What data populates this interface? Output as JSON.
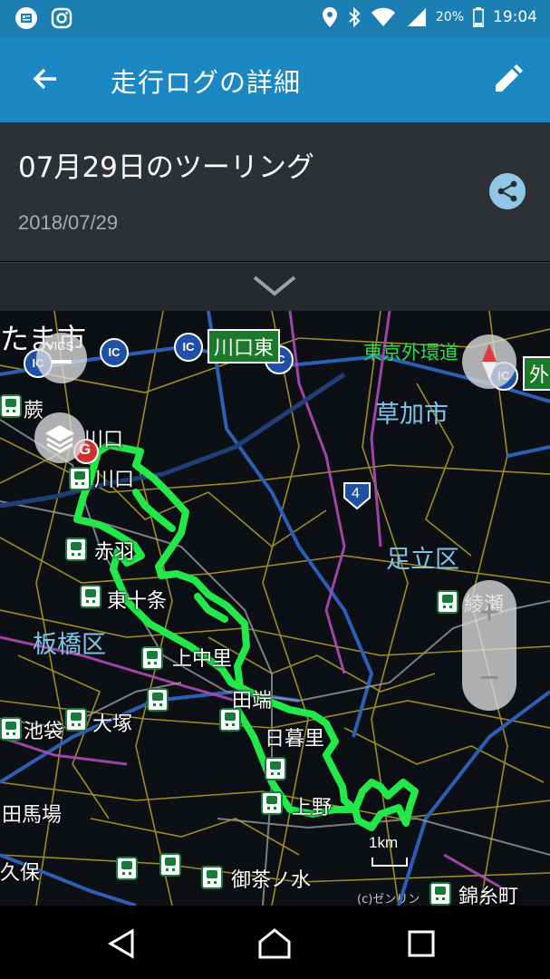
{
  "status_bar": {
    "left_icons": [
      "news-icon",
      "instagram-icon"
    ],
    "right_icons": [
      "location-icon",
      "bluetooth-icon",
      "wifi-icon",
      "signal-icon"
    ],
    "battery": "20%",
    "time": "19:04"
  },
  "app_bar": {
    "title": "走行ログの詳細",
    "back_icon": "arrow-back-icon",
    "edit_icon": "pencil-icon"
  },
  "trip": {
    "title": "07月29日のツーリング",
    "date": "2018/07/29",
    "share_icon": "share-icon"
  },
  "expander": {
    "icon": "chevron-down-icon"
  },
  "map": {
    "vics_label": "VICS",
    "ic_label": "IC",
    "goal_marker": "G",
    "route_number": "4",
    "signs": [
      "川口東",
      "外"
    ],
    "ring_road": "東京外環道",
    "districts": [
      "草加市",
      "足立区",
      "板橋区",
      "たま市"
    ],
    "places": [
      "蕨",
      "川口",
      "川口",
      "赤羽",
      "東十条",
      "上中里",
      "田端",
      "日暮里",
      "上野",
      "池袋",
      "大塚",
      "田馬場",
      "久保",
      "御茶ノ水",
      "錦糸町",
      "綾瀬"
    ],
    "scale_label": "1km",
    "copyright": "(c)ゼンリン",
    "zoom_in": "+",
    "zoom_out": "−",
    "route_color": "#22e84a"
  },
  "nav_bar": {
    "back": "back-triangle-icon",
    "home": "home-icon",
    "recents": "recents-icon"
  }
}
